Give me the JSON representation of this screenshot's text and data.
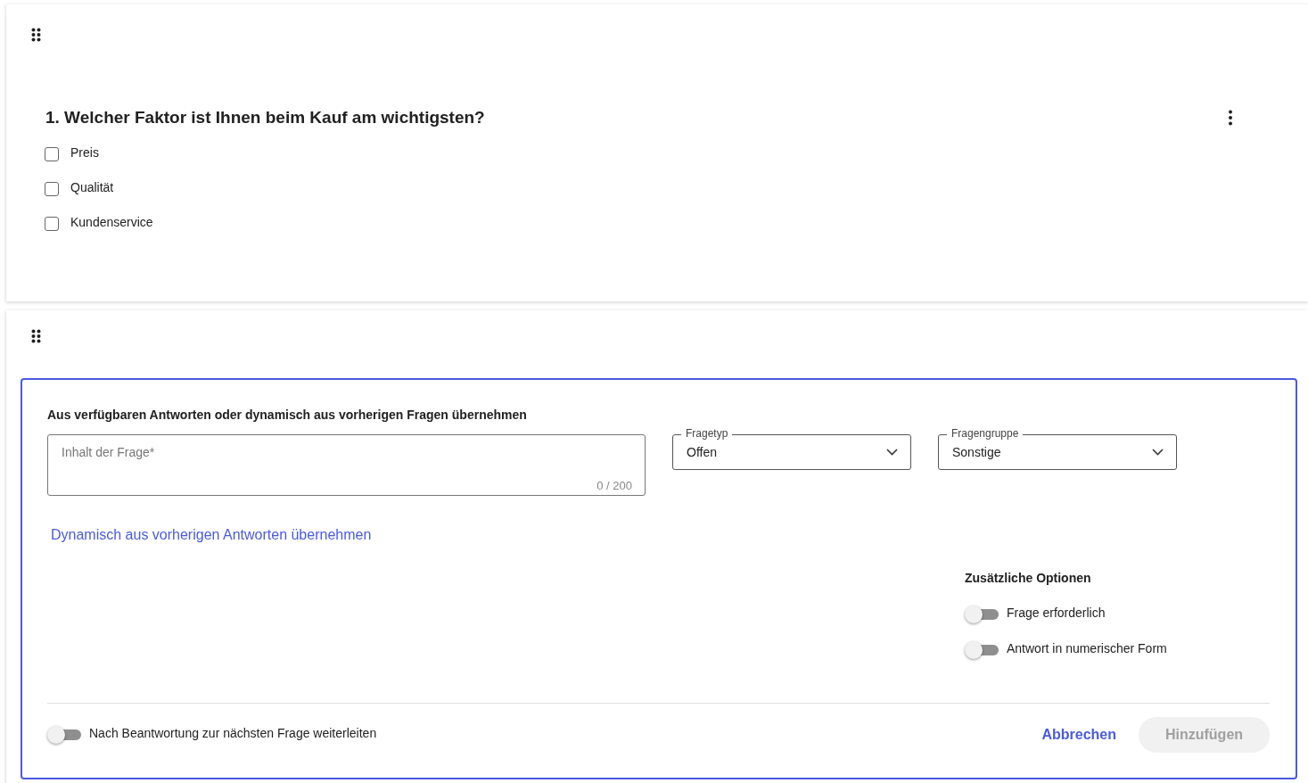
{
  "question_card": {
    "title": "1. Welcher Faktor ist Ihnen beim Kauf am wichtigsten?",
    "options": [
      {
        "label": "Preis",
        "checked": false
      },
      {
        "label": "Qualität",
        "checked": false
      },
      {
        "label": "Kundenservice",
        "checked": false
      }
    ]
  },
  "editor": {
    "heading": "Aus verfügbaren Antworten oder dynamisch aus vorherigen Fragen übernehmen",
    "content_field": {
      "placeholder": "Inhalt der Frage*",
      "counter": "0 / 200"
    },
    "selects": [
      {
        "label": "Fragetyp",
        "value": "Offen"
      },
      {
        "label": "Fragengruppe",
        "value": "Sonstige"
      }
    ],
    "dynamic_link": "Dynamisch aus vorherigen Antworten übernehmen",
    "options_title": "Zusätzliche Optionen",
    "toggles": [
      {
        "label": "Frage erforderlich",
        "on": false
      },
      {
        "label": "Antwort in numerischer Form",
        "on": false
      }
    ],
    "forward_toggle": {
      "label": "Nach Beantwortung zur nächsten Frage weiterleiten",
      "on": false
    },
    "cancel": "Abbrechen",
    "submit": {
      "label": "Hinzufügen",
      "disabled": true
    }
  }
}
